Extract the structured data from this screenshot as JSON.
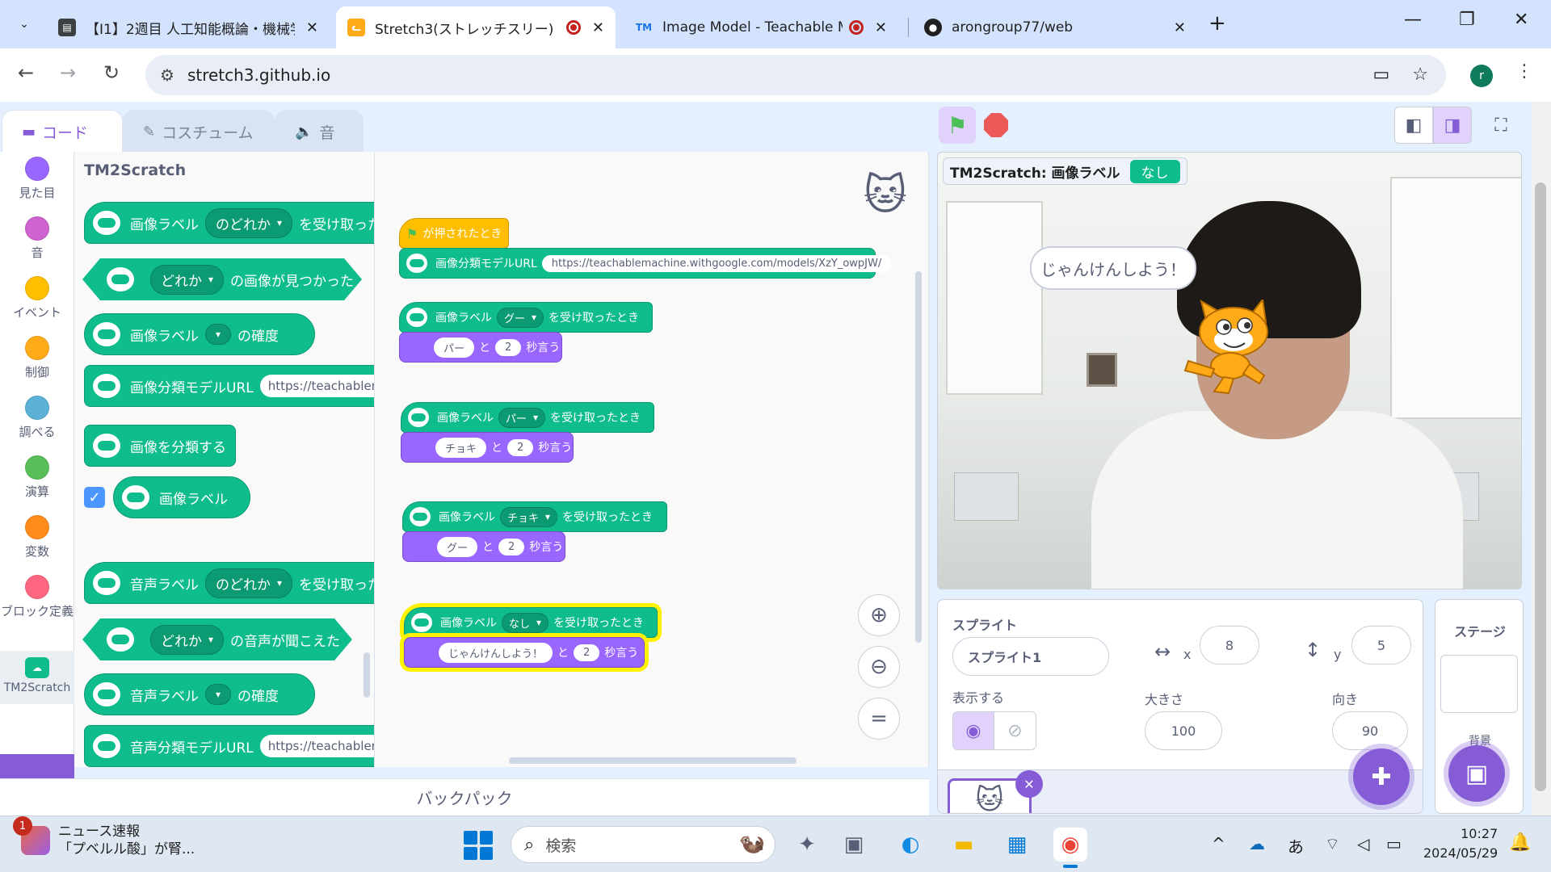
{
  "browser": {
    "tabs": [
      {
        "title": "【I1】2週目 人工知能概論・機械学",
        "favicon": "book-icon",
        "close": "✕"
      },
      {
        "title": "Stretch3(ストレッチスリー)",
        "favicon": "scratch-cat-icon",
        "close": "✕"
      },
      {
        "title": "Image Model - Teachable M",
        "favicon": "TM",
        "close": "✕"
      },
      {
        "title": "arongroup77/web",
        "favicon": "github-icon",
        "close": "✕"
      }
    ],
    "url": "stretch3.github.io",
    "profile_initial": "r"
  },
  "editor": {
    "tabs": {
      "code": "コード",
      "costumes": "コスチューム",
      "sounds": "音"
    },
    "categories": [
      {
        "label": "見た目",
        "color": "#9966ff"
      },
      {
        "label": "音",
        "color": "#cf63cf"
      },
      {
        "label": "イベント",
        "color": "#ffbf00"
      },
      {
        "label": "制御",
        "color": "#ffab19"
      },
      {
        "label": "調べる",
        "color": "#5cb1d6"
      },
      {
        "label": "演算",
        "color": "#59c059"
      },
      {
        "label": "変数",
        "color": "#ff8c1a"
      },
      {
        "label": "ブロック定義",
        "color": "#ff6680"
      },
      {
        "label": "TM2Scratch",
        "color": "#0fbd8c"
      }
    ],
    "flyout": {
      "heading": "TM2Scratch",
      "blocks": {
        "img_when_label_pre": "画像ラベル",
        "img_when_label_dd": "のどれか",
        "img_when_label_post": "を受け取ったとき",
        "img_found_dd": "どれか",
        "img_found_post": "の画像が見つかった",
        "img_conf_pre": "画像ラベル",
        "img_conf_post": "の確度",
        "img_model_pre": "画像分類モデルURL",
        "img_model_val": "https://teachablemachine.withgoogle.com/models/XzY_owpJW/",
        "img_classify": "画像を分類する",
        "img_label_reporter": "画像ラベル",
        "snd_when_label_pre": "音声ラベル",
        "snd_when_label_dd": "のどれか",
        "snd_when_label_post": "を受け取ったとき",
        "snd_heard_dd": "どれか",
        "snd_heard_post": "の音声が聞こえた",
        "snd_conf_pre": "音声ラベル",
        "snd_conf_post": "の確度",
        "snd_model_pre": "音声分類モデルURL",
        "snd_model_val": "https://teachablemachine.withgoogle.com/models/"
      }
    },
    "script": {
      "green_flag_hat": "が押されたとき",
      "model_url_label": "画像分類モデルURL",
      "model_url_value": "https://teachablemachine.withgoogle.com/models/XzY_owpJW/",
      "handlers": [
        {
          "label": "画像ラベル",
          "value": "グー",
          "suffix": "を受け取ったとき",
          "say": "パー",
          "and": "と",
          "secs": "2",
          "say_suffix": "秒言う"
        },
        {
          "label": "画像ラベル",
          "value": "パー",
          "suffix": "を受け取ったとき",
          "say": "チョキ",
          "and": "と",
          "secs": "2",
          "say_suffix": "秒言う"
        },
        {
          "label": "画像ラベル",
          "value": "チョキ",
          "suffix": "を受け取ったとき",
          "say": "グー",
          "and": "と",
          "secs": "2",
          "say_suffix": "秒言う"
        },
        {
          "label": "画像ラベル",
          "value": "なし",
          "suffix": "を受け取ったとき",
          "say": "じゃんけんしよう！",
          "and": "と",
          "secs": "2",
          "say_suffix": "秒言う"
        }
      ]
    },
    "backpack": "バックパック"
  },
  "stage": {
    "monitor_label": "TM2Scratch: 画像ラベル",
    "monitor_value": "なし",
    "speech": "じゃんけんしよう！"
  },
  "sprite_info": {
    "heading": "スプライト",
    "name": "スプライト1",
    "x_label": "x",
    "x": "8",
    "y_label": "y",
    "y": "5",
    "show_label": "表示する",
    "size_label": "大きさ",
    "size": "100",
    "direction_label": "向き",
    "direction": "90"
  },
  "stage_pane": {
    "heading": "ステージ",
    "backdrops_label": "背景"
  },
  "taskbar": {
    "news_title": "ニュース速報",
    "news_subtitle": "「プベルル酸」が腎...",
    "news_badge": "1",
    "search_placeholder": "検索",
    "ime": "あ",
    "time": "10:27",
    "date": "2024/05/29"
  }
}
